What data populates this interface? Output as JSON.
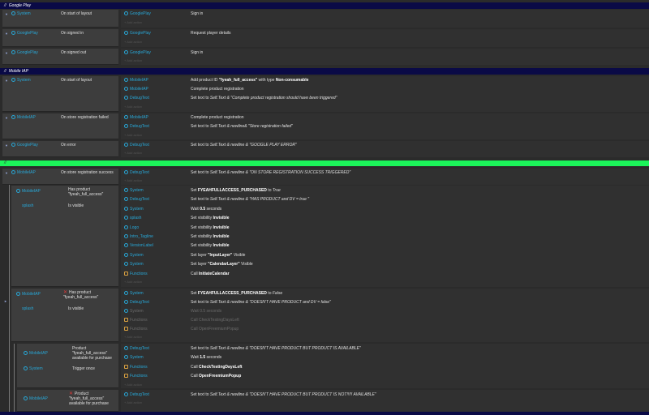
{
  "groups": {
    "google_play": "Google Play",
    "mobile_iap": "Mobile IAP",
    "third": ""
  },
  "add_action": "+ Add action",
  "ev1": {
    "cond_obj": "System",
    "cond_text": "On start of layout",
    "actions": [
      {
        "obj": "GooglePlay",
        "text": "Sign in"
      }
    ]
  },
  "ev2": {
    "cond_obj": "GooglePlay",
    "cond_text": "On signed in",
    "actions": [
      {
        "obj": "GooglePlay",
        "text": "Request player details"
      }
    ]
  },
  "ev3": {
    "cond_obj": "GooglePlay",
    "cond_text": "On signed out",
    "actions": [
      {
        "obj": "GooglePlay",
        "text": "Sign in"
      }
    ]
  },
  "ev4": {
    "cond_obj": "System",
    "cond_text": "On start of layout",
    "actions": [
      {
        "obj": "MobileIAP",
        "pre": "Add product ID ",
        "b": "\"fyeah_full_access\"",
        "mid": " with type ",
        "b2": "Non-consumable"
      },
      {
        "obj": "MobileIAP",
        "text": "Complete product registration"
      },
      {
        "obj": "DebugText",
        "pre": "Set text to ",
        "i": "Self.Text & \"Complete product registration should have been triggered\""
      }
    ]
  },
  "ev5": {
    "cond_obj": "MobileIAP",
    "cond_text": "On store registration failed",
    "actions": [
      {
        "obj": "MobileIAP",
        "text": "Complete product registration"
      },
      {
        "obj": "DebugText",
        "pre": "Set text to ",
        "i": "Self.Text & newline& \"Store registration failed\""
      }
    ]
  },
  "ev6": {
    "cond_obj": "GooglePlay",
    "cond_text": "On error",
    "actions": [
      {
        "obj": "DebugText",
        "pre": "Set text to ",
        "i": "Self.Text & newline & \"GOOGLE PLAY ERROR\""
      }
    ]
  },
  "ev7": {
    "cond_obj": "MobileIAP",
    "cond_text": "On store registration success",
    "actions": [
      {
        "obj": "DebugText",
        "pre": "Set text to ",
        "i": "Self.Text & newline & \"ON STORE REGISTRATION SUCCESS TRIGGERED\""
      }
    ]
  },
  "sub1": {
    "c1_obj": "MobileIAP",
    "c1_text": "Has product \"fyeah_full_access\"",
    "c2_obj": "splash",
    "c2_text": "Is visible",
    "actions": [
      {
        "obj": "System",
        "pre": "Set ",
        "b": "FYEAHFULLACCESS_PURCHASED",
        "mid": " to ",
        "i": "True"
      },
      {
        "obj": "DebugText",
        "pre": "Set text to ",
        "i": "Self.Text & newline & \"HAS PRODUCT and DV = true \""
      },
      {
        "obj": "System",
        "pre": "Wait ",
        "b": "0.5",
        "mid": " seconds"
      },
      {
        "obj": "splash",
        "pre": "Set visibility ",
        "b": "Invisible"
      },
      {
        "obj": "Logo",
        "pre": "Set visibility ",
        "b": "Invisible"
      },
      {
        "obj": "Intro_TagIine",
        "pre": "Set visibility ",
        "b": "Invisible"
      },
      {
        "obj": "VersionLabel",
        "pre": "Set visibility ",
        "b": "Invisible"
      },
      {
        "obj": "System",
        "pre": "Set layer ",
        "b": "\"InputLayer\"",
        "mid": " Visible"
      },
      {
        "obj": "System",
        "pre": "Set layer ",
        "b": "\"CalendarLayer\"",
        "mid": " Visible"
      },
      {
        "obj": "Functions",
        "pre": "Call ",
        "b": "InitiateCalendar"
      }
    ]
  },
  "sub2": {
    "c1_obj": "MobileIAP",
    "c1_text": "Has product \"fyeah_full_access\"",
    "c2_obj": "splash",
    "c2_text": "Is visible",
    "actions": [
      {
        "obj": "System",
        "pre": "Set ",
        "b": "FYEAHFULLACCESS_PURCHASED",
        "mid": " to ",
        "i": "False"
      },
      {
        "obj": "DebugText",
        "pre": "Set text to ",
        "i": "Self.Text & newline & \"DOESN'T HAVE PRODUCT and DV = false\""
      },
      {
        "obj": "System",
        "dim": true,
        "text": "Wait 0.5 seconds"
      },
      {
        "obj": "Functions",
        "dim": true,
        "text": "Call CheckTestingDaysLeft"
      },
      {
        "obj": "Functions",
        "dim": true,
        "text": "Call OpenFreemiumPopup"
      }
    ]
  },
  "sub3": {
    "c1_obj": "MobileIAP",
    "c1_text": "Product \"fyeah_full_access\" available for purchase",
    "c2_obj": "System",
    "c2_text": "Trigger once",
    "actions": [
      {
        "obj": "DebugText",
        "pre": "Set text to ",
        "i": "Self.Text & newline & \"DOESN'T HAVE PRODUCT BUT PRODUCT IS AVAILABLE\""
      },
      {
        "obj": "System",
        "pre": "Wait ",
        "b": "1.5",
        "mid": " seconds"
      },
      {
        "obj": "Functions",
        "pre": "Call ",
        "b": "CheckTestingDaysLeft"
      },
      {
        "obj": "Functions",
        "pre": "Call ",
        "b": "OpenFreemiumPopup"
      }
    ]
  },
  "sub4": {
    "c1_obj": "MobileIAP",
    "c1_text": "Product \"fyeah_full_access\" available for purchase",
    "actions": [
      {
        "obj": "DebugText",
        "pre": "Set text to ",
        "i": "Self.Text & newline & \"DOESN'T HAVE PRODUCT BUT PRODUCT IS NOT!!!!! AVAILABLE\""
      }
    ]
  }
}
